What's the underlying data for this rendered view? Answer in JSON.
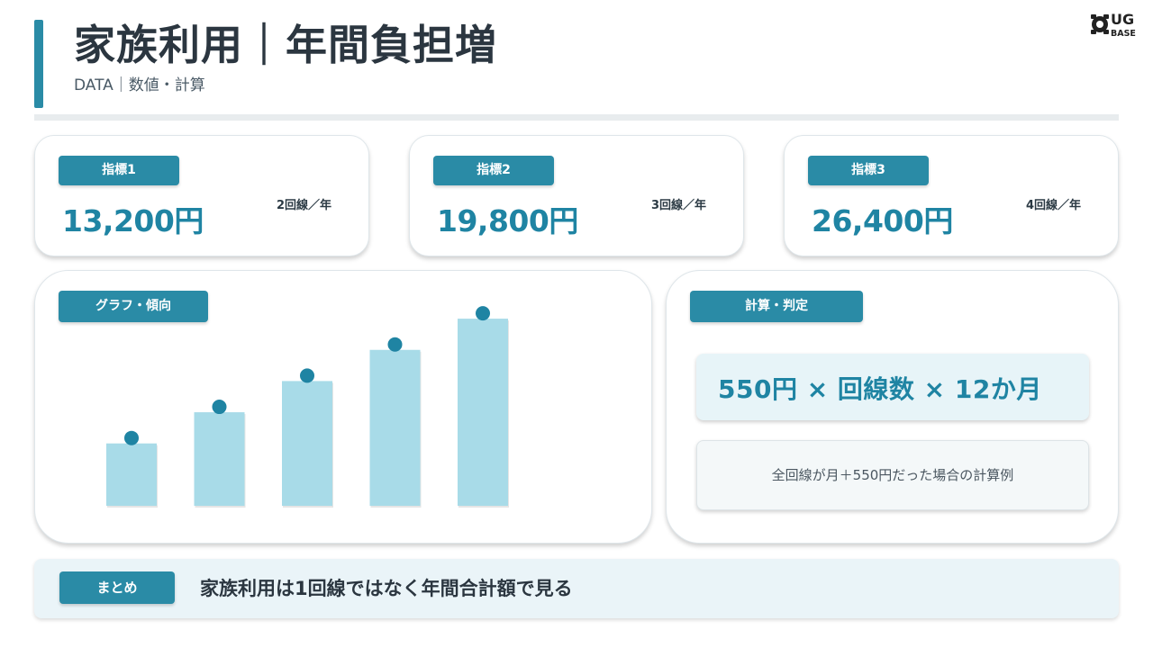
{
  "header": {
    "title": "家族利用｜年間負担増",
    "subtitle": "DATA｜数値・計算",
    "logo": {
      "top": "UG",
      "bottom": "BASE"
    }
  },
  "kpis": [
    {
      "label": "指標1",
      "value": "13,200円",
      "unit": "2回線／年"
    },
    {
      "label": "指標2",
      "value": "19,800円",
      "unit": "3回線／年"
    },
    {
      "label": "指標3",
      "value": "26,400円",
      "unit": "4回線／年"
    }
  ],
  "chart_panel": {
    "label": "グラフ・傾向"
  },
  "chart_data": {
    "type": "bar",
    "title": "",
    "xlabel": "",
    "ylabel": "",
    "ylim": [
      0,
      40000
    ],
    "categories": [
      "",
      "",
      "",
      "",
      ""
    ],
    "values": [
      13200,
      19800,
      26400,
      33000,
      39600
    ],
    "bar_color": "#a8dbe8",
    "marker_color": "#1f84a3",
    "grid": false,
    "axis_visible": false
  },
  "calc_panel": {
    "label": "計算・判定",
    "formula": "550円 × 回線数 × 12か月",
    "note": "全回線が月＋550円だった場合の計算例"
  },
  "summary": {
    "label": "まとめ",
    "text": "家族利用は1回線ではなく年間合計額で見る"
  },
  "colors": {
    "accent": "#2a8ba6",
    "value_text": "#1f84a3",
    "bar": "#a8dbe8"
  }
}
